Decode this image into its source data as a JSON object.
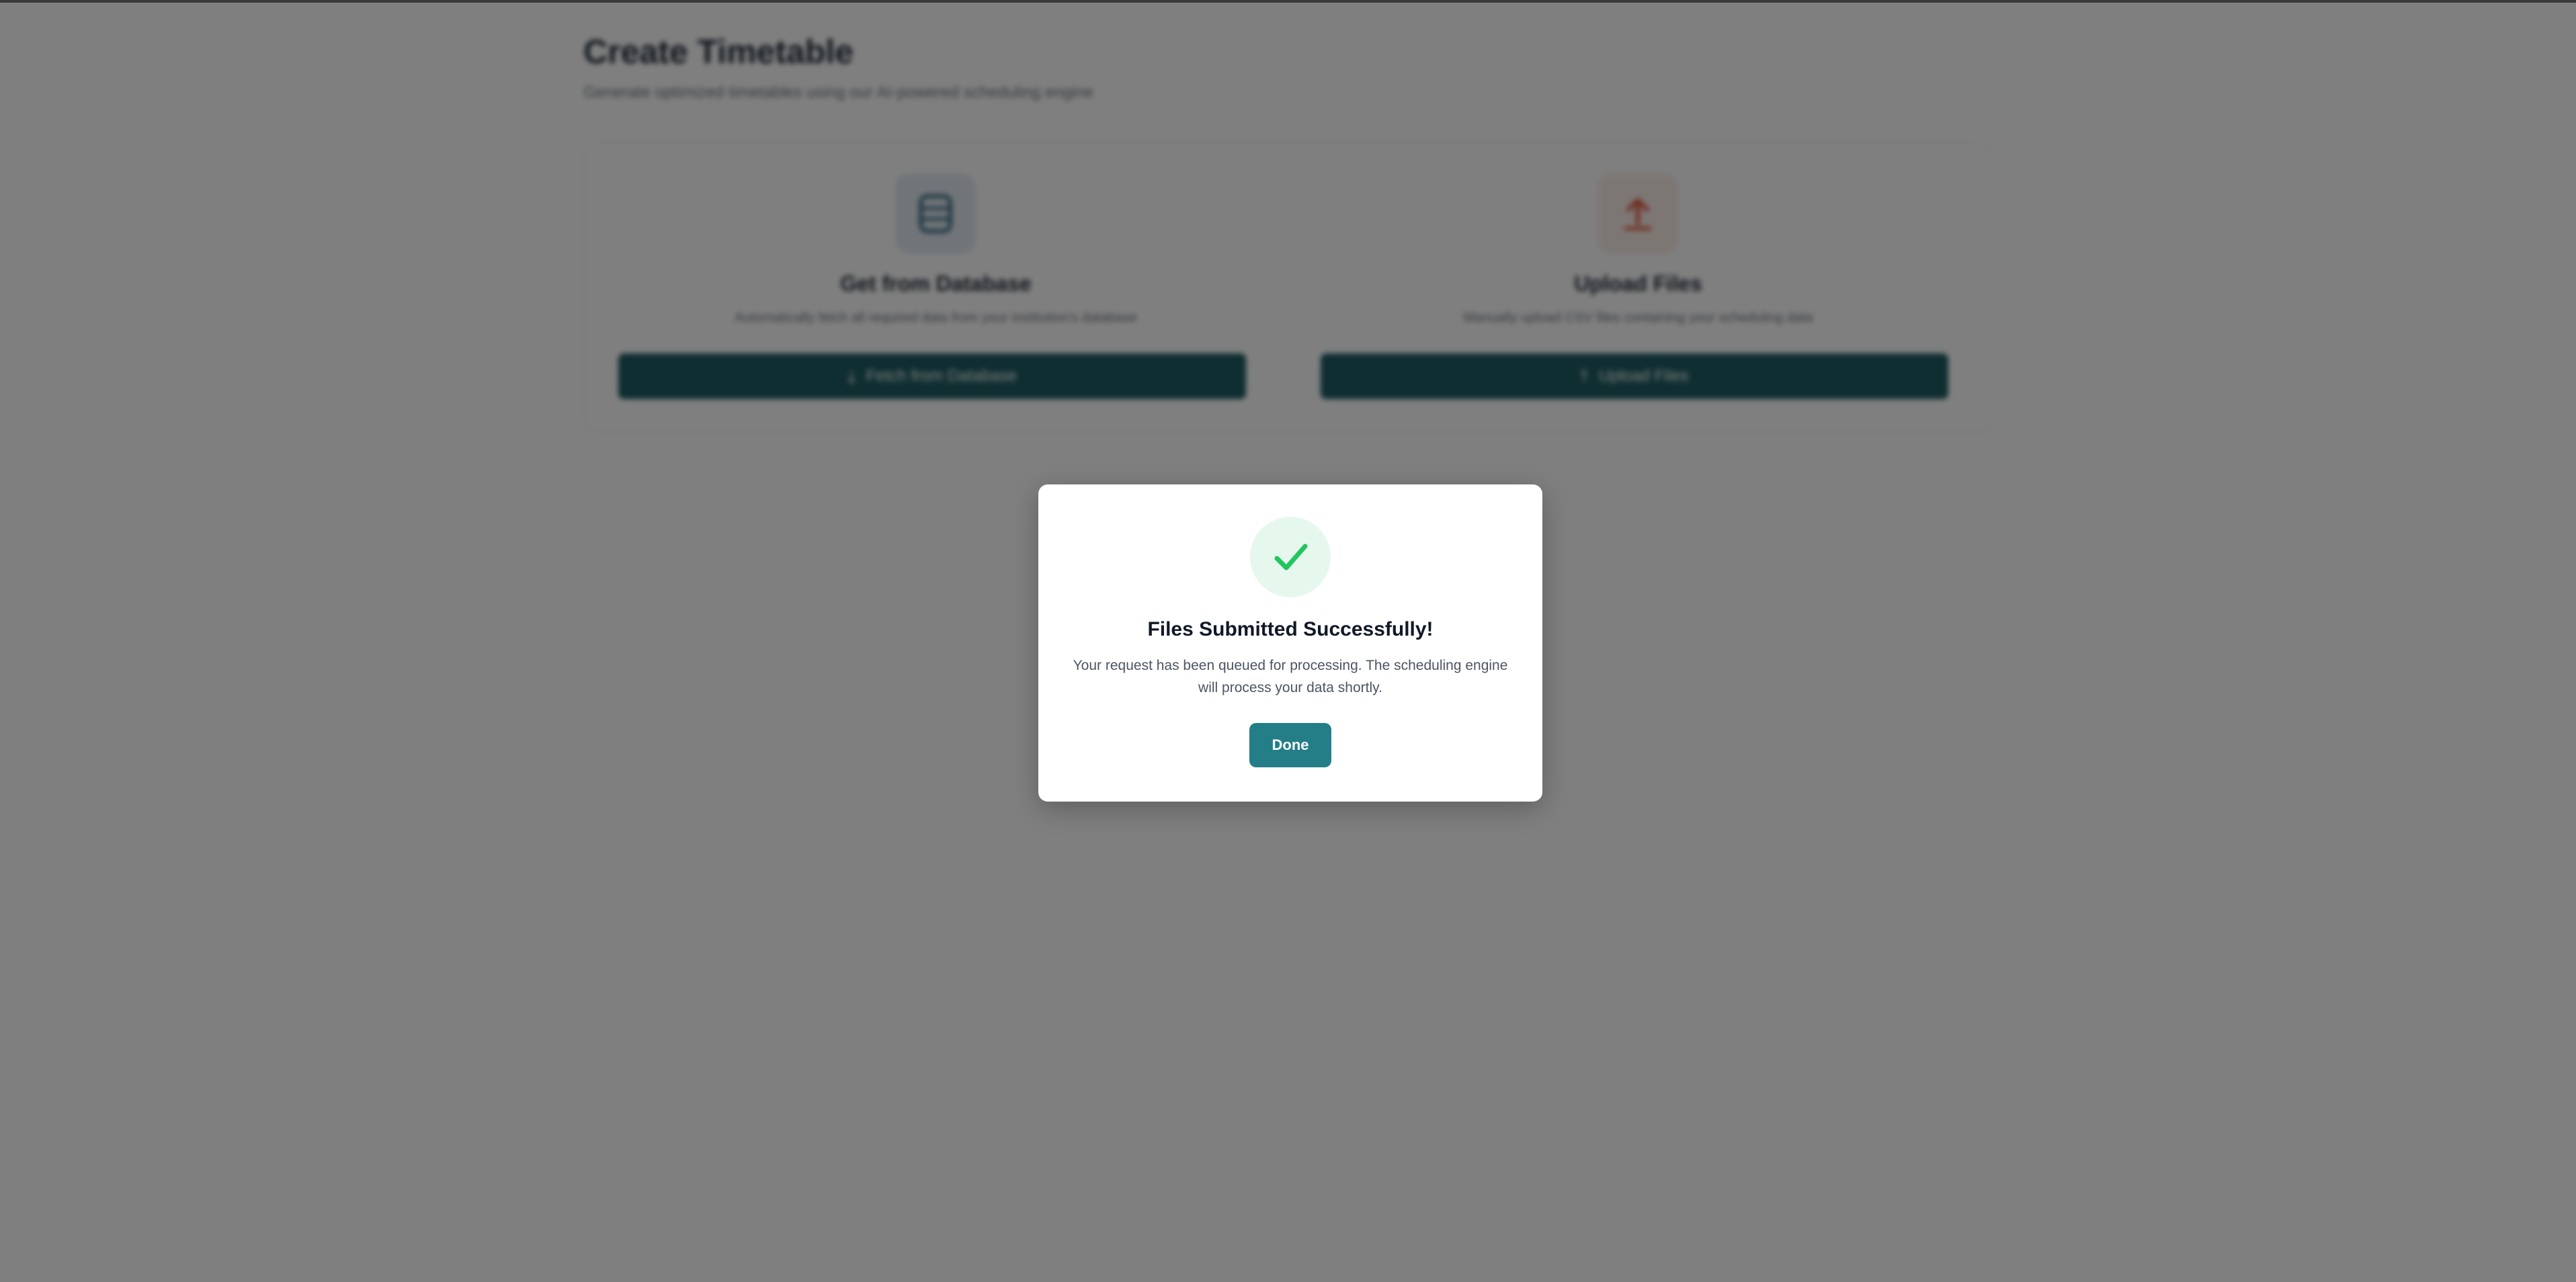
{
  "page": {
    "title": "Create Timetable",
    "subtitle": "Generate optimized timetables using our AI-powered scheduling engine"
  },
  "options": [
    {
      "icon": "database-icon",
      "title": "Get from Database",
      "description": "Automatically fetch all required data from your institution's database",
      "button_label": "Fetch from Database",
      "button_icon": "download-icon",
      "icon_color": "#3f6f86"
    },
    {
      "icon": "upload-icon",
      "title": "Upload Files",
      "description": "Manually upload CSV files containing your scheduling data",
      "button_label": "Upload Files",
      "button_icon": "upload-icon",
      "icon_color": "#e0553b"
    }
  ],
  "modal": {
    "icon": "check-icon",
    "title": "Files Submitted Successfully!",
    "message": "Your request has been queued for processing. The scheduling engine will process your data shortly.",
    "done_label": "Done"
  },
  "colors": {
    "primary": "#237e87",
    "card_button": "#1f5c63",
    "success": "#22c55e",
    "success_bg": "#e6f8ed",
    "overlay": "rgba(0,0,0,0.5)"
  }
}
